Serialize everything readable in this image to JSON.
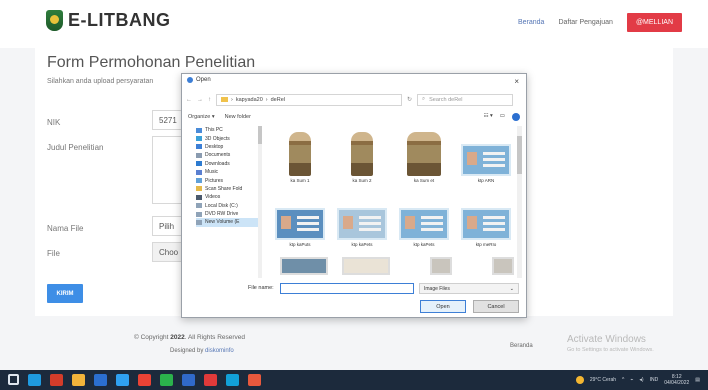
{
  "header": {
    "logo_text": "E-LITBANG",
    "nav": {
      "home": "Beranda",
      "list": "Daftar Pengajuan",
      "account": "@MELLIAN"
    }
  },
  "form": {
    "title": "Form Permohonan Penelitian",
    "subtitle": "Silahkan anda upload persyaratan",
    "nik_label": "NIK",
    "nik_value": "5271",
    "judul_label": "Judul Penelitian",
    "nama_file_label": "Nama File",
    "nama_file_value": "Pilih",
    "file_label": "File",
    "file_button": "Choo",
    "submit": "KIRIM"
  },
  "footer": {
    "copyright_prefix": "© Copyright ",
    "year": "2022",
    "copyright_suffix": ". All Rights Reserved",
    "designed_prefix": "Designed by ",
    "designer": "​diskominfo",
    "link": "Beranda",
    "activate_title": "Activate Windows",
    "activate_sub": "Go to Settings to activate Windows."
  },
  "dialog": {
    "title": "Open",
    "close": "×",
    "path": [
      "kapyada20",
      "deRel"
    ],
    "search_placeholder": "Search deRel",
    "organize": "Organize ▾",
    "new_folder": "New folder",
    "tree": [
      {
        "label": "This PC",
        "color": "#4a8bd8"
      },
      {
        "label": "3D Objects",
        "color": "#3aa0d8"
      },
      {
        "label": "Desktop",
        "color": "#3d7fd6"
      },
      {
        "label": "Documents",
        "color": "#8a9bb0"
      },
      {
        "label": "Downloads",
        "color": "#2d7bd0"
      },
      {
        "label": "Music",
        "color": "#5a7fd0"
      },
      {
        "label": "Pictures",
        "color": "#60a0d8"
      },
      {
        "label": "Scan Share Fold",
        "color": "#e4b94a"
      },
      {
        "label": "Videos",
        "color": "#4b5a6d"
      },
      {
        "label": "Local Disk (C:)",
        "color": "#8fa3b8"
      },
      {
        "label": "DVD RW Drive",
        "color": "#8fa3b8"
      },
      {
        "label": "New Volume (E",
        "color": "#8fa3b8"
      }
    ],
    "files_row1": [
      "ka Sum 1",
      "ka Sum 2",
      "ka Sum et",
      "ktp ARN"
    ],
    "files_row2": [
      "ktp kaPuts",
      "ktp kaPets",
      "ktp kaPets",
      "ktp meRIo"
    ],
    "filename_label": "File name:",
    "filetype": "Image Files",
    "open": "Open",
    "cancel": "Cancel"
  },
  "taskbar": {
    "icons": [
      "#3b7ddd",
      "#1f9be0",
      "#d33c2a",
      "#f2b43b",
      "#2b6fd0",
      "#2fa0f0",
      "#ea4335",
      "#2bb24c",
      "#3069c9",
      "#e03a3a",
      "#12a0d8",
      "#e8593d"
    ],
    "weather": "29°C Cerah",
    "lang": "IND",
    "time": "8:12",
    "date": "04/04/2022"
  }
}
